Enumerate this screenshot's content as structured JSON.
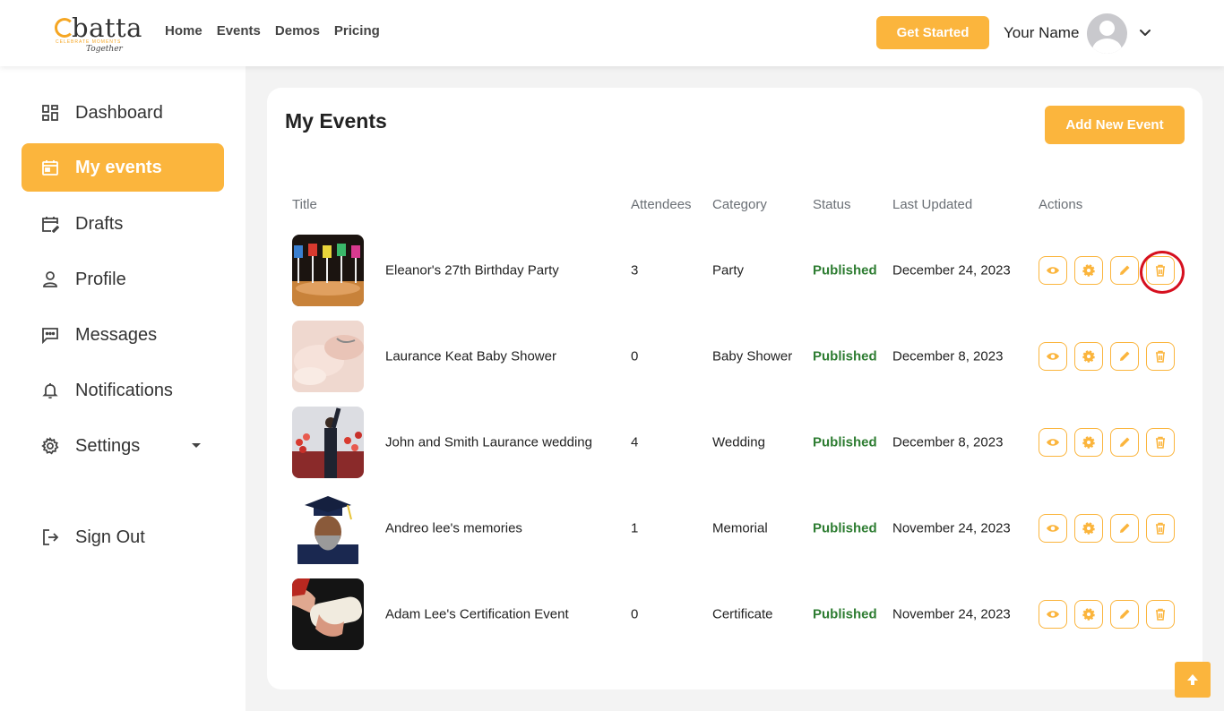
{
  "brand": {
    "name": "batta",
    "tagline": "CELEBRATE MOMENTS",
    "signature": "Together"
  },
  "nav": {
    "items": [
      "Home",
      "Events",
      "Demos",
      "Pricing"
    ]
  },
  "header": {
    "cta_label": "Get Started",
    "user_name": "Your Name"
  },
  "sidebar": {
    "items": [
      {
        "label": "Dashboard",
        "icon": "dashboard-icon"
      },
      {
        "label": "My events",
        "icon": "calendar-icon",
        "active": true
      },
      {
        "label": "Drafts",
        "icon": "calendar-edit-icon"
      },
      {
        "label": "Profile",
        "icon": "person-icon"
      },
      {
        "label": "Messages",
        "icon": "message-icon"
      },
      {
        "label": "Notifications",
        "icon": "bell-icon"
      },
      {
        "label": "Settings",
        "icon": "gear-icon"
      }
    ],
    "signout_label": "Sign Out"
  },
  "main": {
    "title": "My Events",
    "add_label": "Add New Event",
    "columns": [
      "Title",
      "Attendees",
      "Category",
      "Status",
      "Last Updated",
      "Actions"
    ],
    "rows": [
      {
        "title": "Eleanor's 27th Birthday Party",
        "attendees": "3",
        "category": "Party",
        "status": "Published",
        "updated": "December 24, 2023"
      },
      {
        "title": "Laurance Keat Baby Shower",
        "attendees": "0",
        "category": "Baby Shower",
        "status": "Published",
        "updated": "December 8, 2023"
      },
      {
        "title": "John and Smith Laurance wedding",
        "attendees": "4",
        "category": "Wedding",
        "status": "Published",
        "updated": "December 8, 2023"
      },
      {
        "title": "Andreo lee's memories",
        "attendees": "1",
        "category": "Memorial",
        "status": "Published",
        "updated": "November 24, 2023"
      },
      {
        "title": "Adam Lee's Certification Event",
        "attendees": "0",
        "category": "Certificate",
        "status": "Published",
        "updated": "November 24, 2023"
      }
    ]
  },
  "colors": {
    "accent": "#fbb53d",
    "published": "#2e7d32",
    "highlight": "#d6101f"
  }
}
